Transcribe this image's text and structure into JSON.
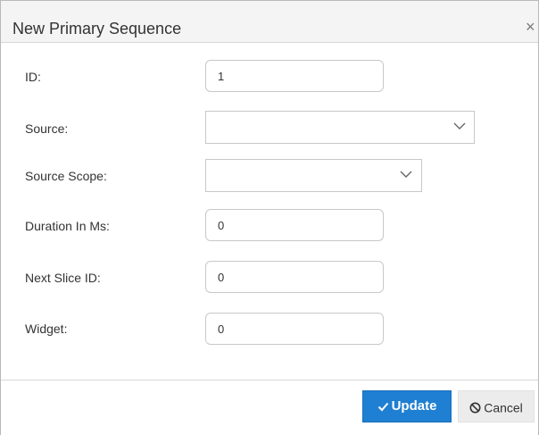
{
  "dialog": {
    "title": "New Primary Sequence",
    "close_label": "×"
  },
  "form": {
    "id": {
      "label": "ID:",
      "value": "1"
    },
    "source": {
      "label": "Source:",
      "value": "",
      "icon": "chevron-down-icon"
    },
    "source_scope": {
      "label": "Source Scope:",
      "value": "",
      "icon": "chevron-down-icon"
    },
    "duration_in_ms": {
      "label": "Duration In Ms:",
      "value": "0"
    },
    "next_slice_id": {
      "label": "Next Slice ID:",
      "value": "0"
    },
    "widget": {
      "label": "Widget:",
      "value": "0"
    }
  },
  "footer": {
    "update_label": "Update",
    "update_icon": "check-icon",
    "cancel_label": "Cancel",
    "cancel_icon": "cancel-circle-icon"
  },
  "colors": {
    "accent": "#1f7fd2",
    "header_bg": "#f4f4f4",
    "cancel_bg": "#ececec"
  }
}
